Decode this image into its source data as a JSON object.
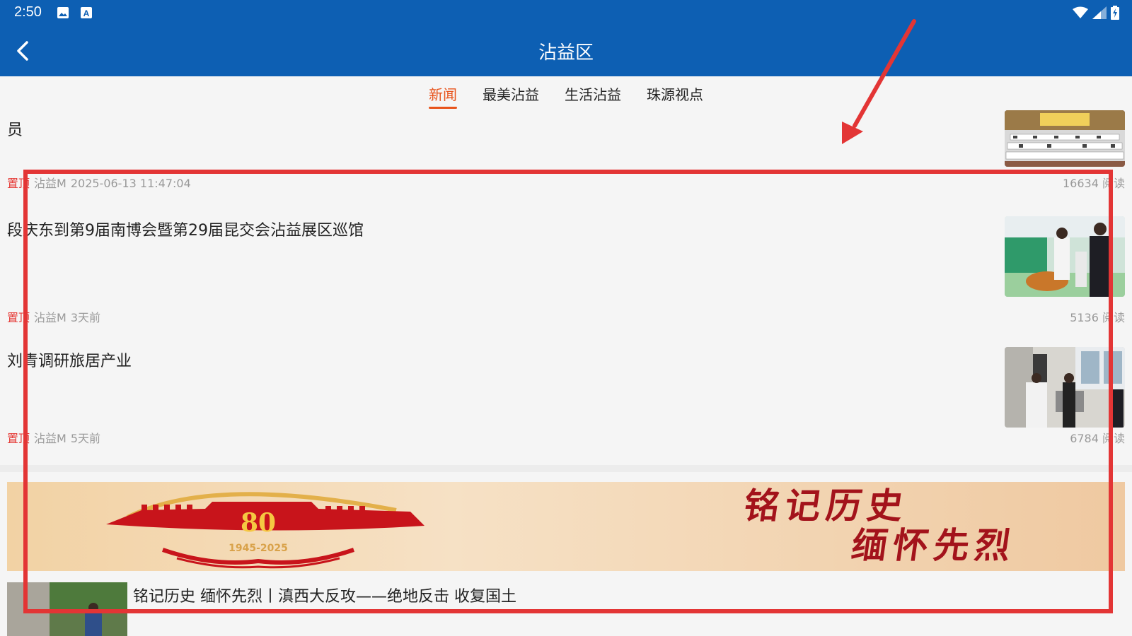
{
  "status_bar": {
    "time": "2:50",
    "left_icons": [
      "image-icon",
      "text-a-icon"
    ],
    "right_icons": [
      "wifi-icon",
      "signal-icon",
      "battery-icon"
    ]
  },
  "header": {
    "title": "沾益区",
    "back_icon": "chevron-left-icon",
    "bg_color": "#0d5fb3"
  },
  "tabs": [
    {
      "label": "新闻",
      "active": true
    },
    {
      "label": "最美沾益",
      "active": false
    },
    {
      "label": "生活沾益",
      "active": false
    },
    {
      "label": "珠源视点",
      "active": false
    }
  ],
  "news": [
    {
      "title": "员",
      "pin": "置顶",
      "source": "沾益M",
      "time": "2025-06-13 11:47:04",
      "reads": "16634 阅读"
    },
    {
      "title": "段庆东到第9届南博会暨第29届昆交会沾益展区巡馆",
      "pin": "置顶",
      "source": "沾益M",
      "time": "3天前",
      "reads": "5136 阅读"
    },
    {
      "title": "刘青调研旅居产业",
      "pin": "置顶",
      "source": "沾益M",
      "time": "5天前",
      "reads": "6784 阅读"
    }
  ],
  "banner": {
    "emblem_number": "80",
    "emblem_years": "1945-2025",
    "line1": "铭记历史",
    "line2": "缅怀先烈"
  },
  "bottom_article": {
    "title": "铭记历史 缅怀先烈丨滇西大反攻——绝地反击 收复国土"
  },
  "colors": {
    "accent": "#e8541c",
    "pin": "#e53935",
    "annotation": "#e33535"
  }
}
